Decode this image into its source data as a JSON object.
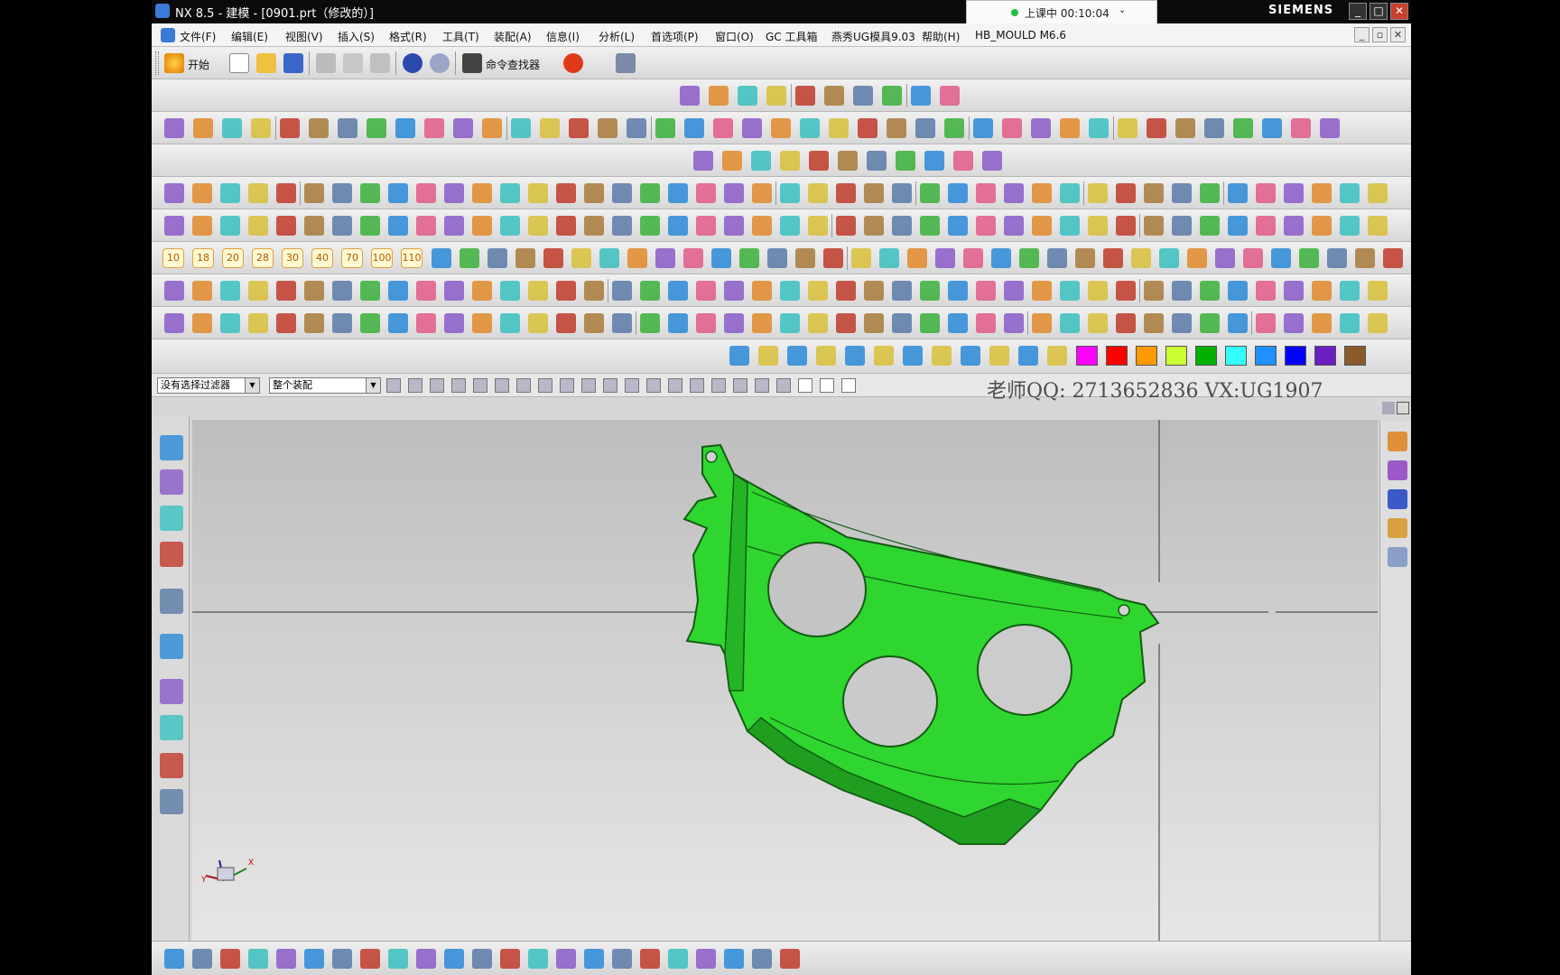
{
  "window": {
    "title": "NX 8.5 - 建模 - [0901.prt（修改的）]",
    "brand": "SIEMENS",
    "minimize": "_",
    "maximize": "□",
    "close": "✕"
  },
  "recording": {
    "status": "上课中 00:10:04",
    "chevron": "⌄"
  },
  "menu": [
    "文件(F)",
    "编辑(E)",
    "视图(V)",
    "插入(S)",
    "格式(R)",
    "工具(T)",
    "装配(A)",
    "信息(I)",
    "分析(L)",
    "首选项(P)",
    "窗口(O)",
    "GC 工具箱",
    "燕秀UG模具9.03",
    "帮助(H)",
    "HB_MOULD M6.6"
  ],
  "toolbar_standard": {
    "start_label": "开始",
    "command_finder_label": "命令查找器"
  },
  "layer_buttons": [
    "10",
    "18",
    "20",
    "28",
    "30",
    "40",
    "70",
    "100",
    "110"
  ],
  "color_swatches": [
    "#ff00ff",
    "#ff0000",
    "#ff9900",
    "#ccff33",
    "#00b000",
    "#33ffff",
    "#1e90ff",
    "#0000ff",
    "#6a1fc0",
    "#8b5a2b"
  ],
  "selection_bar": {
    "filter": "没有选择过滤器",
    "scope": "整个装配"
  },
  "watermark": "老师QQ: 2713652836 VX:UG1907",
  "icons": {
    "app": "nx-logo-icon",
    "part_color": "#2fd62f"
  }
}
